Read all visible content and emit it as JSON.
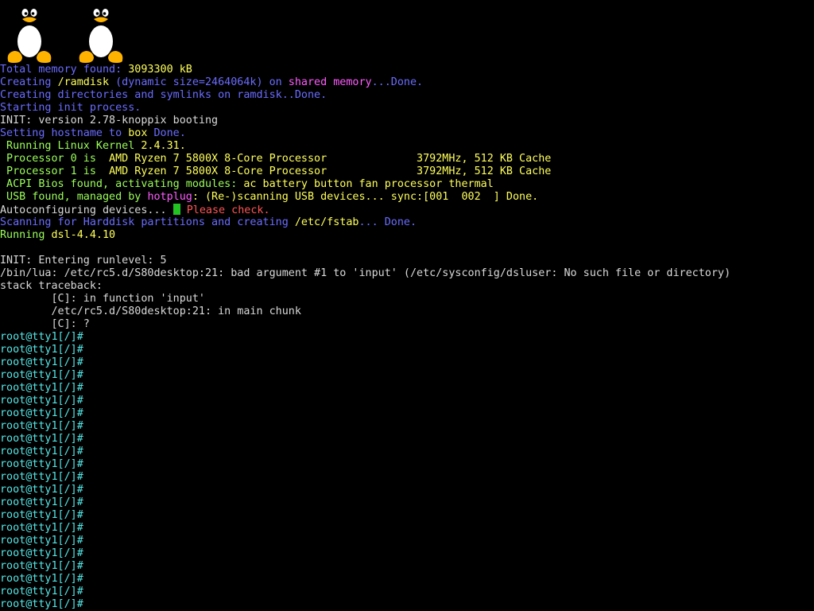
{
  "colors": {
    "background": "#000000",
    "blue": "#6a6cff",
    "white": "#d9d9d9",
    "yellow": "#ffff5a",
    "magenta": "#ff5cff",
    "green": "#9cff5a",
    "cyan": "#55e6e6",
    "red": "#ff5555",
    "cursor": "#22c322",
    "tux_black": "#000000",
    "tux_white": "#ffffff",
    "tux_yellow": "#ffb300"
  },
  "logos": [
    {
      "name": "tux-logo-1",
      "icon": "tux-penguin-icon"
    },
    {
      "name": "tux-logo-2",
      "icon": "tux-penguin-icon"
    }
  ],
  "lines": [
    {
      "name": "memory-line",
      "segments": [
        {
          "text": "Total memory found: ",
          "color": "blue"
        },
        {
          "text": "3093300 kB",
          "color": "yellow"
        }
      ]
    },
    {
      "name": "ramdisk-line",
      "segments": [
        {
          "text": "Creating ",
          "color": "blue"
        },
        {
          "text": "/ramdisk",
          "color": "yellow"
        },
        {
          "text": " (dynamic size=2464064k) on ",
          "color": "blue"
        },
        {
          "text": "shared memory",
          "color": "magenta"
        },
        {
          "text": "...Done.",
          "color": "blue"
        }
      ]
    },
    {
      "name": "symlinks-line",
      "segments": [
        {
          "text": "Creating directories and symlinks on ramdisk..Done.",
          "color": "blue"
        }
      ]
    },
    {
      "name": "init-start-line",
      "segments": [
        {
          "text": "Starting init process.",
          "color": "blue"
        }
      ]
    },
    {
      "name": "init-version-line",
      "segments": [
        {
          "text": "INIT: version 2.78-knoppix booting",
          "color": "white"
        }
      ]
    },
    {
      "name": "hostname-line",
      "segments": [
        {
          "text": "Setting hostname to ",
          "color": "blue"
        },
        {
          "text": "box",
          "color": "yellow"
        },
        {
          "text": " Done.",
          "color": "blue"
        }
      ]
    },
    {
      "name": "kernel-line",
      "segments": [
        {
          "text": " Running Linux Kernel ",
          "color": "green"
        },
        {
          "text": "2.4.31.",
          "color": "yellow"
        }
      ]
    },
    {
      "name": "processor-0-line",
      "segments": [
        {
          "text": " Processor 0 is  ",
          "color": "green"
        },
        {
          "text": "AMD Ryzen 7 5800X 8-Core Processor              3792MHz, 512 KB Cache",
          "color": "yellow"
        }
      ]
    },
    {
      "name": "processor-1-line",
      "segments": [
        {
          "text": " Processor 1 is  ",
          "color": "green"
        },
        {
          "text": "AMD Ryzen 7 5800X 8-Core Processor              3792MHz, 512 KB Cache",
          "color": "yellow"
        }
      ]
    },
    {
      "name": "acpi-line",
      "segments": [
        {
          "text": " ACPI Bios found, activating modules: ",
          "color": "green"
        },
        {
          "text": "ac battery button fan processor thermal",
          "color": "yellow"
        }
      ]
    },
    {
      "name": "usb-line",
      "segments": [
        {
          "text": " USB found, managed by ",
          "color": "green"
        },
        {
          "text": "hotplug",
          "color": "magenta"
        },
        {
          "text": ": (Re-)scanning USB devices... sync:[001  002  ] Done.",
          "color": "yellow"
        }
      ]
    },
    {
      "name": "autoconfig-line",
      "segments": [
        {
          "text": "Autoconfiguring devices... ",
          "color": "white"
        },
        {
          "cursor": true
        },
        {
          "text": " Please check.",
          "color": "red"
        }
      ]
    },
    {
      "name": "harddisk-line",
      "segments": [
        {
          "text": "Scanning for Harddisk partitions and creating ",
          "color": "blue"
        },
        {
          "text": "/etc/fstab",
          "color": "yellow"
        },
        {
          "text": "... Done.",
          "color": "blue"
        }
      ]
    },
    {
      "name": "dsl-line",
      "segments": [
        {
          "text": "Running ",
          "color": "green"
        },
        {
          "text": "dsl-4.4.10",
          "color": "yellow"
        }
      ]
    },
    {
      "name": "blank-line",
      "segments": [
        {
          "text": "",
          "color": "white"
        }
      ]
    },
    {
      "name": "runlevel-line",
      "segments": [
        {
          "text": "INIT: Entering runlevel: 5",
          "color": "white"
        }
      ]
    },
    {
      "name": "lua-error-line",
      "segments": [
        {
          "text": "/bin/lua: /etc/rc5.d/S80desktop:21: bad argument #1 to 'input' (/etc/sysconfig/dsluser: No such file or directory)",
          "color": "white"
        }
      ]
    },
    {
      "name": "traceback-line",
      "segments": [
        {
          "text": "stack traceback:",
          "color": "white"
        }
      ]
    },
    {
      "name": "traceback-frame-1",
      "segments": [
        {
          "text": "        [C]: in function 'input'",
          "color": "white"
        }
      ]
    },
    {
      "name": "traceback-frame-2",
      "segments": [
        {
          "text": "        /etc/rc5.d/S80desktop:21: in main chunk",
          "color": "white"
        }
      ]
    },
    {
      "name": "traceback-frame-3",
      "segments": [
        {
          "text": "        [C]: ?",
          "color": "white"
        }
      ]
    }
  ],
  "prompt": {
    "text": "root@tty1[/]#",
    "color": "cyan",
    "count": 22
  }
}
